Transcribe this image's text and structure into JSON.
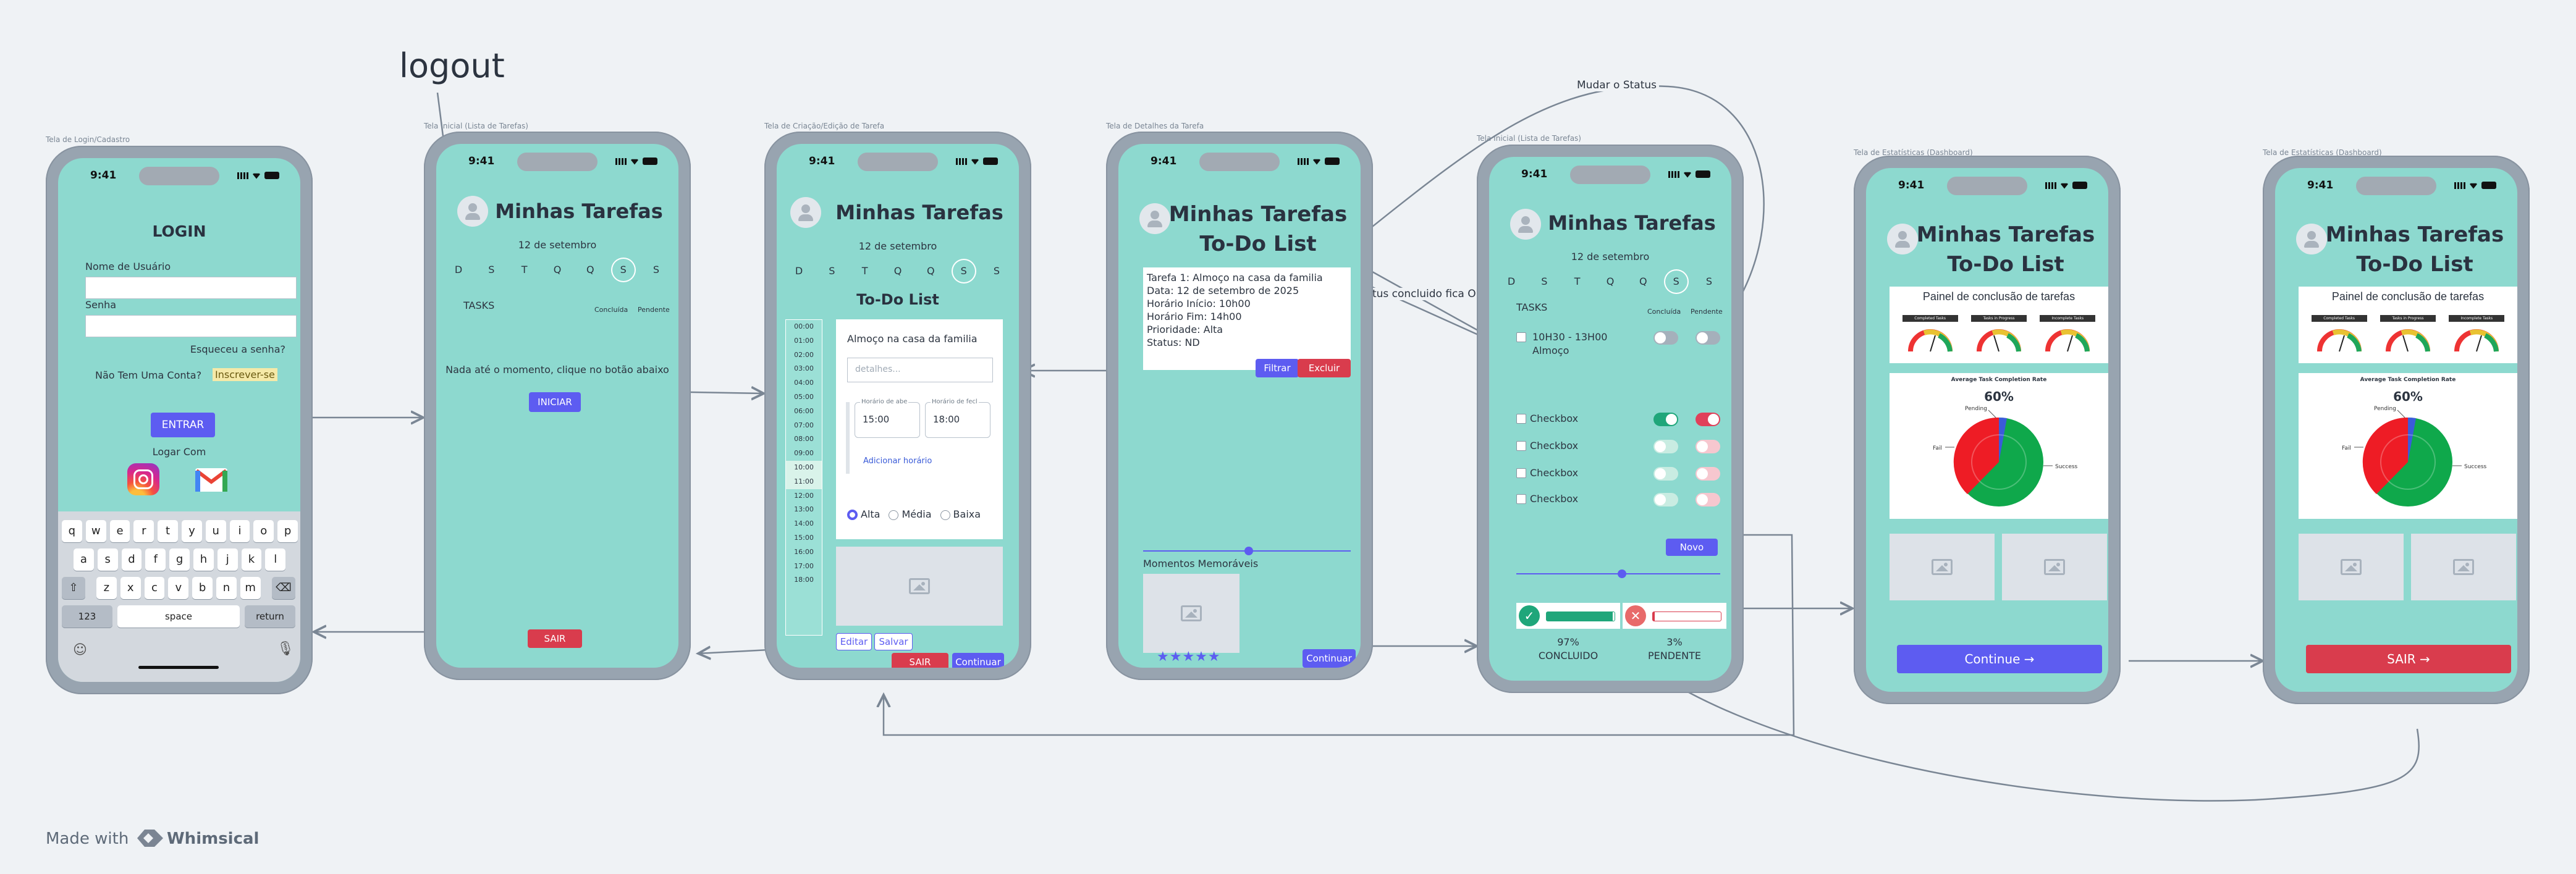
{
  "annotations": {
    "logout": "logout",
    "mudar_status": "Mudar o Status",
    "status_concluido": "status concluido fica Ok"
  },
  "frame_labels": {
    "login": "Tela de Login/Cadastro",
    "home": "Tela Inicial (Lista de Tarefas)",
    "create": "Tela de Criação/Edição de Tarefa",
    "details": "Tela de Detalhes da Tarefa",
    "home2": "Tela Inicial (Lista de Tarefas)",
    "stats1": "Tela de Estatísticas (Dashboard)",
    "stats2": "Tela de Estatísticas (Dashboard)"
  },
  "status_time": "9:41",
  "login": {
    "title": "LOGIN",
    "username_label": "Nome de Usuário",
    "password_label": "Senha",
    "forgot": "Esqueceu a senha?",
    "no_account": "Não Tem Uma Conta?",
    "signup": "Inscrever-se",
    "enter": "ENTRAR",
    "login_with": "Logar Com",
    "keyboard": {
      "row1": [
        "q",
        "w",
        "e",
        "r",
        "t",
        "y",
        "u",
        "i",
        "o",
        "p"
      ],
      "row2": [
        "a",
        "s",
        "d",
        "f",
        "g",
        "h",
        "j",
        "k",
        "l"
      ],
      "row3": [
        "z",
        "x",
        "c",
        "v",
        "b",
        "n",
        "m"
      ],
      "numbers": "123",
      "space": "space",
      "return": "return"
    }
  },
  "home": {
    "title": "Minhas Tarefas",
    "date": "12 de setembro",
    "days": [
      "D",
      "S",
      "T",
      "Q",
      "Q",
      "S",
      "S"
    ],
    "tasks_label": "TASKS",
    "concluded": "Concluída",
    "pending": "Pendente",
    "empty": "Nada até o momento, clique no botão abaixo",
    "start": "INICIAR",
    "exit": "SAIR"
  },
  "create": {
    "title": "Minhas Tarefas",
    "date": "12 de setembro",
    "days": [
      "D",
      "S",
      "T",
      "Q",
      "Q",
      "S",
      "S"
    ],
    "subtitle": "To-Do List",
    "times": [
      "00:00",
      "01:00",
      "02:00",
      "03:00",
      "04:00",
      "05:00",
      "06:00",
      "07:00",
      "08:00",
      "09:00",
      "10:00",
      "11:00",
      "12:00",
      "13:00",
      "14:00",
      "15:00",
      "16:00",
      "17:00",
      "18:00"
    ],
    "task_name": "Almoço na casa da familia",
    "details_placeholder": "detalhes...",
    "start_label": "Horário de abe",
    "start_value": "15:00",
    "end_label": "Horário de fecl",
    "end_value": "18:00",
    "add_time": "Adicionar horário",
    "priorities": [
      "Alta",
      "Média",
      "Baixa"
    ],
    "edit": "Editar",
    "save": "Salvar",
    "exit": "SAIR",
    "continue": "Continuar"
  },
  "details": {
    "title_line1": "Minhas Tarefas",
    "title_line2": "To-Do List",
    "lines": [
      "Tarefa 1: Almoço na casa da familia",
      "Data: 12 de setembro de 2025",
      "Horário Início: 10h00",
      "Horário Fim: 14h00",
      "Prioridade: Alta",
      "Status: ND"
    ],
    "filter": "Filtrar",
    "delete": "Excluir",
    "memories": "Momentos Memoráveis",
    "stars": "★★★★★",
    "continue": "Continuar"
  },
  "home2": {
    "title": "Minhas Tarefas",
    "date": "12 de setembro",
    "days": [
      "D",
      "S",
      "T",
      "Q",
      "Q",
      "S",
      "S"
    ],
    "tasks_label": "TASKS",
    "concluded": "Concluída",
    "pending": "Pendente",
    "task_line1": "10H30 - 13H00",
    "task_line2": "Almoço",
    "checkbox_label": "Checkbox",
    "new": "Novo",
    "done_pct": "97%",
    "done_label": "CONCLUIDO",
    "pending_pct": "3%",
    "pending_label": "PENDENTE",
    "progress": 0.97,
    "pending_progress": 0.03
  },
  "stats": {
    "title_line1": "Minhas Tarefas",
    "title_line2": "To-Do List",
    "panel_title": "Painel de conclusão de tarefas",
    "gauges": [
      "Completed Tasks",
      "Tasks in Progress",
      "Incomplete Tasks"
    ],
    "chart_title": "Average Task Completion Rate",
    "center_pct": "60%",
    "pie_labels": [
      "Fail",
      "Success",
      "Pending"
    ],
    "continue": "Continue →",
    "exit": "SAIR →"
  },
  "branding": {
    "made_with": "Made with",
    "brand": "Whimsical"
  },
  "colors": {
    "background": "#eff2f5",
    "screen": "#8dd9cf",
    "phone": "#98a4b0",
    "primary": "#5d5cf1",
    "danger": "#d93c4d",
    "success": "#1fa67a"
  }
}
